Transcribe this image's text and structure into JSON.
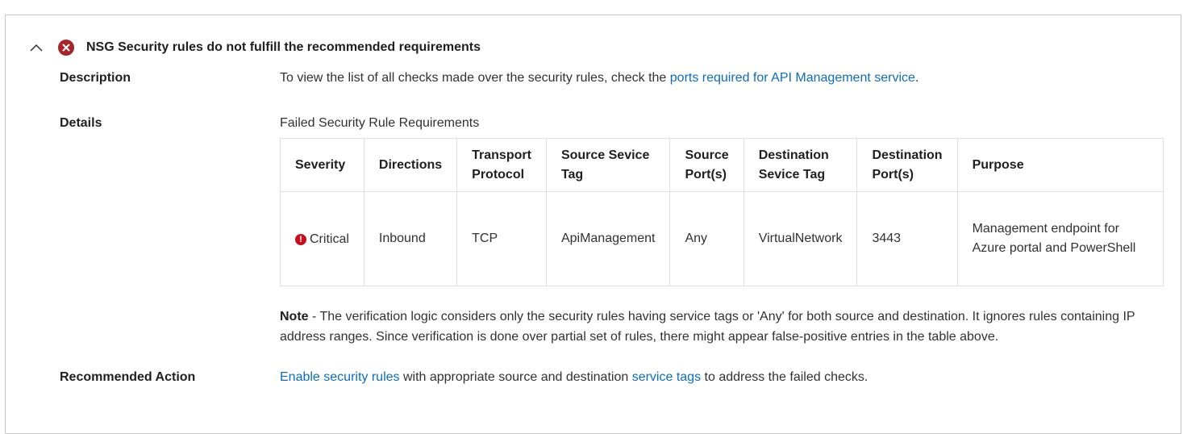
{
  "header": {
    "title": "NSG Security rules do not fulfill the recommended requirements"
  },
  "description": {
    "label": "Description",
    "text_before": "To view the list of all checks made over the security rules, check the ",
    "link": "ports required for API Management service",
    "text_after": "."
  },
  "details": {
    "label": "Details",
    "subtitle": "Failed Security Rule Requirements",
    "columns": [
      "Severity",
      "Directions",
      "Transport Protocol",
      "Source Sevice Tag",
      "Source Port(s)",
      "Destination Sevice Tag",
      "Destination Port(s)",
      "Purpose"
    ],
    "rows": [
      {
        "severity": "Critical",
        "direction": "Inbound",
        "protocol": "TCP",
        "source_tag": "ApiManagement",
        "source_ports": "Any",
        "destination_tag": "VirtualNetwork",
        "destination_ports": "3443",
        "purpose": "Management endpoint for Azure portal and PowerShell"
      }
    ],
    "note_label": "Note",
    "note_text": " - The verification logic considers only the security rules having service tags or 'Any' for both source and destination. It ignores rules containing IP address ranges. Since verification is done over partial set of rules, there might appear false-positive entries in the table above."
  },
  "recommended": {
    "label": "Recommended Action",
    "link1": "Enable security rules",
    "text_middle": " with appropriate source and destination ",
    "link2": "service tags",
    "text_after": " to address the failed checks."
  },
  "icons": {
    "collapse": "chevron-up-icon",
    "error": "error-circle-icon",
    "severity": "critical-exclamation-icon"
  },
  "colors": {
    "error": "#a4262c",
    "critical": "#c50f1f",
    "link": "#0f6cbd",
    "border": "#c8c6c4"
  }
}
